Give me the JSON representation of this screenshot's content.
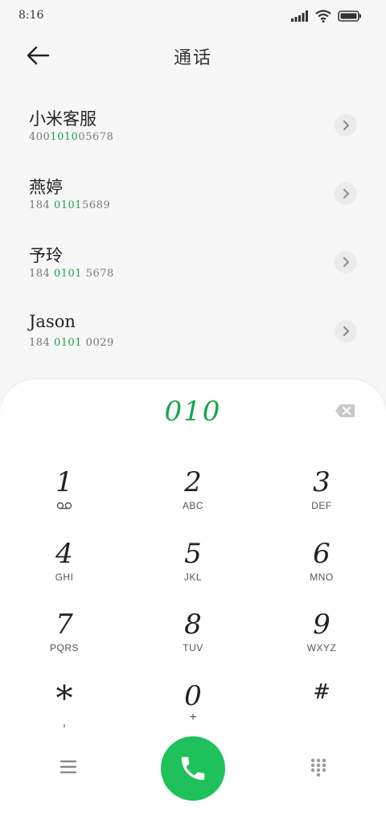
{
  "status": {
    "time": "8:16"
  },
  "header": {
    "title": "通话"
  },
  "contacts": [
    {
      "name": "小米客服",
      "number_pre": "400",
      "number_hl": "1010",
      "number_post": "05678"
    },
    {
      "name": "燕婷",
      "number_pre": "184 ",
      "number_hl": "0101",
      "number_post": "5689"
    },
    {
      "name": "予玲",
      "number_pre": "184 ",
      "number_hl": "0101",
      "number_post": " 5678"
    },
    {
      "name": "Jason",
      "number_pre": "184 ",
      "number_hl": "0101",
      "number_post": " 0029"
    }
  ],
  "dialer": {
    "input": "010",
    "keys": [
      {
        "digit": "1",
        "letters": ""
      },
      {
        "digit": "2",
        "letters": "ABC"
      },
      {
        "digit": "3",
        "letters": "DEF"
      },
      {
        "digit": "4",
        "letters": "GHI"
      },
      {
        "digit": "5",
        "letters": "JKL"
      },
      {
        "digit": "6",
        "letters": "MNO"
      },
      {
        "digit": "7",
        "letters": "PQRS"
      },
      {
        "digit": "8",
        "letters": "TUV"
      },
      {
        "digit": "9",
        "letters": "WXYZ"
      },
      {
        "digit": "*",
        "letters": ","
      },
      {
        "digit": "0",
        "letters": "+"
      },
      {
        "digit": "#",
        "letters": ""
      }
    ]
  },
  "colors": {
    "accent": "#1aa34a",
    "call": "#1ec15a",
    "panel": "#ffffff",
    "background": "#f7f7f7"
  },
  "icons": [
    "signal-icon",
    "wifi-icon",
    "battery-icon",
    "back-arrow-icon",
    "chevron-right-icon",
    "backspace-icon",
    "voicemail-icon",
    "menu-icon",
    "phone-icon",
    "keypad-icon"
  ]
}
